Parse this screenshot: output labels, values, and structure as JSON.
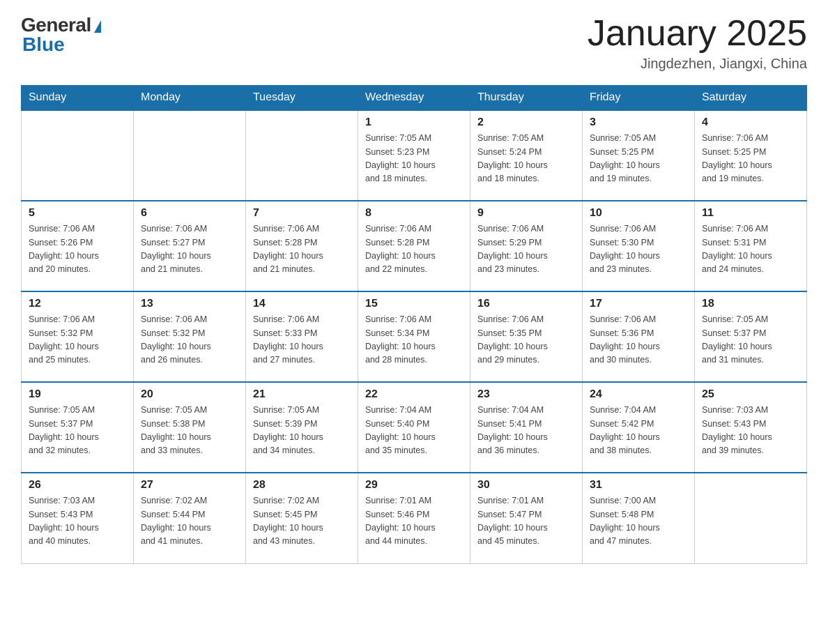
{
  "header": {
    "logo_general": "General",
    "logo_blue": "Blue",
    "title": "January 2025",
    "subtitle": "Jingdezhen, Jiangxi, China"
  },
  "days_of_week": [
    "Sunday",
    "Monday",
    "Tuesday",
    "Wednesday",
    "Thursday",
    "Friday",
    "Saturday"
  ],
  "weeks": [
    [
      {
        "day": "",
        "info": ""
      },
      {
        "day": "",
        "info": ""
      },
      {
        "day": "",
        "info": ""
      },
      {
        "day": "1",
        "info": "Sunrise: 7:05 AM\nSunset: 5:23 PM\nDaylight: 10 hours\nand 18 minutes."
      },
      {
        "day": "2",
        "info": "Sunrise: 7:05 AM\nSunset: 5:24 PM\nDaylight: 10 hours\nand 18 minutes."
      },
      {
        "day": "3",
        "info": "Sunrise: 7:05 AM\nSunset: 5:25 PM\nDaylight: 10 hours\nand 19 minutes."
      },
      {
        "day": "4",
        "info": "Sunrise: 7:06 AM\nSunset: 5:25 PM\nDaylight: 10 hours\nand 19 minutes."
      }
    ],
    [
      {
        "day": "5",
        "info": "Sunrise: 7:06 AM\nSunset: 5:26 PM\nDaylight: 10 hours\nand 20 minutes."
      },
      {
        "day": "6",
        "info": "Sunrise: 7:06 AM\nSunset: 5:27 PM\nDaylight: 10 hours\nand 21 minutes."
      },
      {
        "day": "7",
        "info": "Sunrise: 7:06 AM\nSunset: 5:28 PM\nDaylight: 10 hours\nand 21 minutes."
      },
      {
        "day": "8",
        "info": "Sunrise: 7:06 AM\nSunset: 5:28 PM\nDaylight: 10 hours\nand 22 minutes."
      },
      {
        "day": "9",
        "info": "Sunrise: 7:06 AM\nSunset: 5:29 PM\nDaylight: 10 hours\nand 23 minutes."
      },
      {
        "day": "10",
        "info": "Sunrise: 7:06 AM\nSunset: 5:30 PM\nDaylight: 10 hours\nand 23 minutes."
      },
      {
        "day": "11",
        "info": "Sunrise: 7:06 AM\nSunset: 5:31 PM\nDaylight: 10 hours\nand 24 minutes."
      }
    ],
    [
      {
        "day": "12",
        "info": "Sunrise: 7:06 AM\nSunset: 5:32 PM\nDaylight: 10 hours\nand 25 minutes."
      },
      {
        "day": "13",
        "info": "Sunrise: 7:06 AM\nSunset: 5:32 PM\nDaylight: 10 hours\nand 26 minutes."
      },
      {
        "day": "14",
        "info": "Sunrise: 7:06 AM\nSunset: 5:33 PM\nDaylight: 10 hours\nand 27 minutes."
      },
      {
        "day": "15",
        "info": "Sunrise: 7:06 AM\nSunset: 5:34 PM\nDaylight: 10 hours\nand 28 minutes."
      },
      {
        "day": "16",
        "info": "Sunrise: 7:06 AM\nSunset: 5:35 PM\nDaylight: 10 hours\nand 29 minutes."
      },
      {
        "day": "17",
        "info": "Sunrise: 7:06 AM\nSunset: 5:36 PM\nDaylight: 10 hours\nand 30 minutes."
      },
      {
        "day": "18",
        "info": "Sunrise: 7:05 AM\nSunset: 5:37 PM\nDaylight: 10 hours\nand 31 minutes."
      }
    ],
    [
      {
        "day": "19",
        "info": "Sunrise: 7:05 AM\nSunset: 5:37 PM\nDaylight: 10 hours\nand 32 minutes."
      },
      {
        "day": "20",
        "info": "Sunrise: 7:05 AM\nSunset: 5:38 PM\nDaylight: 10 hours\nand 33 minutes."
      },
      {
        "day": "21",
        "info": "Sunrise: 7:05 AM\nSunset: 5:39 PM\nDaylight: 10 hours\nand 34 minutes."
      },
      {
        "day": "22",
        "info": "Sunrise: 7:04 AM\nSunset: 5:40 PM\nDaylight: 10 hours\nand 35 minutes."
      },
      {
        "day": "23",
        "info": "Sunrise: 7:04 AM\nSunset: 5:41 PM\nDaylight: 10 hours\nand 36 minutes."
      },
      {
        "day": "24",
        "info": "Sunrise: 7:04 AM\nSunset: 5:42 PM\nDaylight: 10 hours\nand 38 minutes."
      },
      {
        "day": "25",
        "info": "Sunrise: 7:03 AM\nSunset: 5:43 PM\nDaylight: 10 hours\nand 39 minutes."
      }
    ],
    [
      {
        "day": "26",
        "info": "Sunrise: 7:03 AM\nSunset: 5:43 PM\nDaylight: 10 hours\nand 40 minutes."
      },
      {
        "day": "27",
        "info": "Sunrise: 7:02 AM\nSunset: 5:44 PM\nDaylight: 10 hours\nand 41 minutes."
      },
      {
        "day": "28",
        "info": "Sunrise: 7:02 AM\nSunset: 5:45 PM\nDaylight: 10 hours\nand 43 minutes."
      },
      {
        "day": "29",
        "info": "Sunrise: 7:01 AM\nSunset: 5:46 PM\nDaylight: 10 hours\nand 44 minutes."
      },
      {
        "day": "30",
        "info": "Sunrise: 7:01 AM\nSunset: 5:47 PM\nDaylight: 10 hours\nand 45 minutes."
      },
      {
        "day": "31",
        "info": "Sunrise: 7:00 AM\nSunset: 5:48 PM\nDaylight: 10 hours\nand 47 minutes."
      },
      {
        "day": "",
        "info": ""
      }
    ]
  ]
}
